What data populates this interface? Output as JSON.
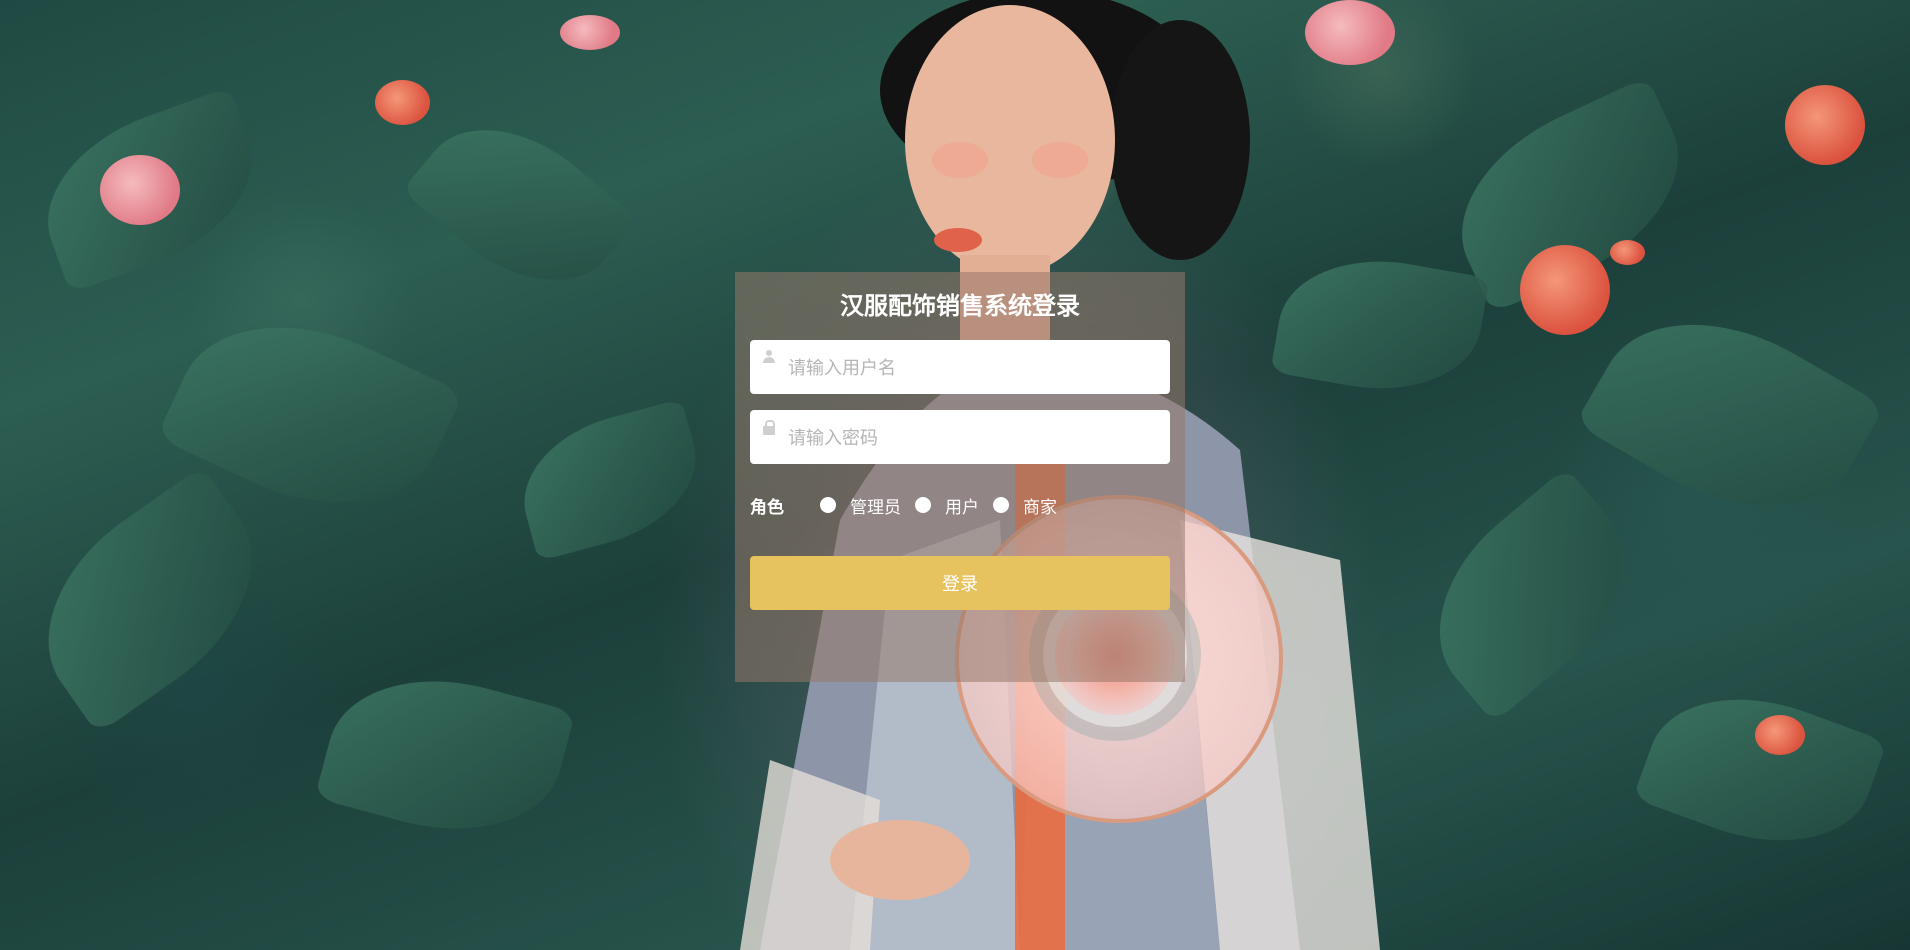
{
  "login": {
    "title": "汉服配饰销售系统登录",
    "username_placeholder": "请输入用户名",
    "password_placeholder": "请输入密码",
    "role_label": "角色",
    "roles": [
      "管理员",
      "用户",
      "商家"
    ],
    "login_label": "登录"
  },
  "colors": {
    "panel_bg": "rgba(150,120,105,0.55)",
    "button_bg": "#e7c35f",
    "text": "#ffffff"
  },
  "icons": {
    "username": "user-icon",
    "password": "lock-icon"
  }
}
